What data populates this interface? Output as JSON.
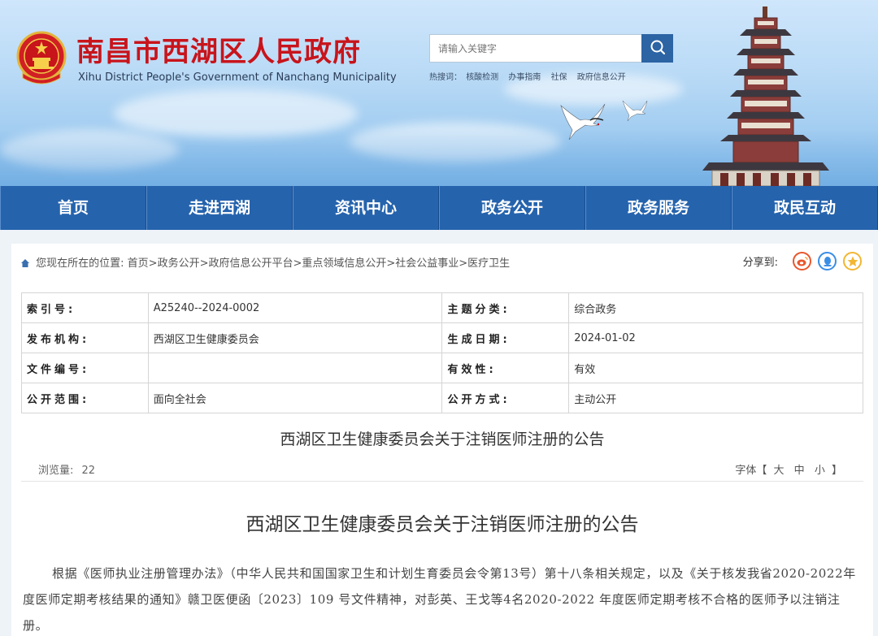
{
  "header": {
    "title": "南昌市西湖区人民政府",
    "subtitle": "Xihu District People's Government of Nanchang Municipality",
    "search_placeholder": "请输入关键字",
    "hot_label": "热搜词：",
    "hot_words": [
      "核酸检测",
      "办事指南",
      "社保",
      "政府信息公开"
    ]
  },
  "nav": {
    "items": [
      "首页",
      "走进西湖",
      "资讯中心",
      "政务公开",
      "政务服务",
      "政民互动"
    ]
  },
  "breadcrumb": {
    "prefix": "您现在所在的位置:",
    "path": "首页>政务公开>政府信息公开平台>重点领域信息公开>社会公益事业>医疗卫生"
  },
  "share": {
    "label": "分享到:",
    "icons": [
      "weibo-icon",
      "qq-icon",
      "qzone-icon"
    ],
    "colors": {
      "weibo": "#e8562c",
      "qq": "#3a8ee6",
      "qzone": "#f2b632"
    }
  },
  "meta": {
    "rows": [
      {
        "k1": "索引号:",
        "v1": "A25240--2024-0002",
        "k2": "主题分类:",
        "v2": "综合政务"
      },
      {
        "k1": "发布机构:",
        "v1": "西湖区卫生健康委员会",
        "k2": "生成日期:",
        "v2": "2024-01-02"
      },
      {
        "k1": "文件编号:",
        "v1": "",
        "k2": "有效性:",
        "v2": "有效"
      },
      {
        "k1": "公开范围:",
        "v1": "面向全社会",
        "k2": "公开方式:",
        "v2": "主动公开"
      }
    ]
  },
  "article": {
    "title_small": "西湖区卫生健康委员会关于注销医师注册的公告",
    "views_label": "浏览量:",
    "views": "22",
    "font_label": "字体【",
    "font_large": "大",
    "font_medium": "中",
    "font_small": "小",
    "font_close": "】",
    "title": "西湖区卫生健康委员会关于注销医师注册的公告",
    "body": "根据《医师执业注册管理办法》（中华人民共和国国家卫生和计划生育委员会令第13号）第十八条相关规定，以及《关于核发我省2020-2022年度医师定期考核结果的通知》赣卫医便函〔2023〕109 号文件精神，对彭英、王戈等4名2020-2022 年度医师定期考核不合格的医师予以注销注册。"
  },
  "colors": {
    "title_red": "#c8141b",
    "nav_blue": "#2563ad",
    "search_blue": "#2c64a4"
  }
}
